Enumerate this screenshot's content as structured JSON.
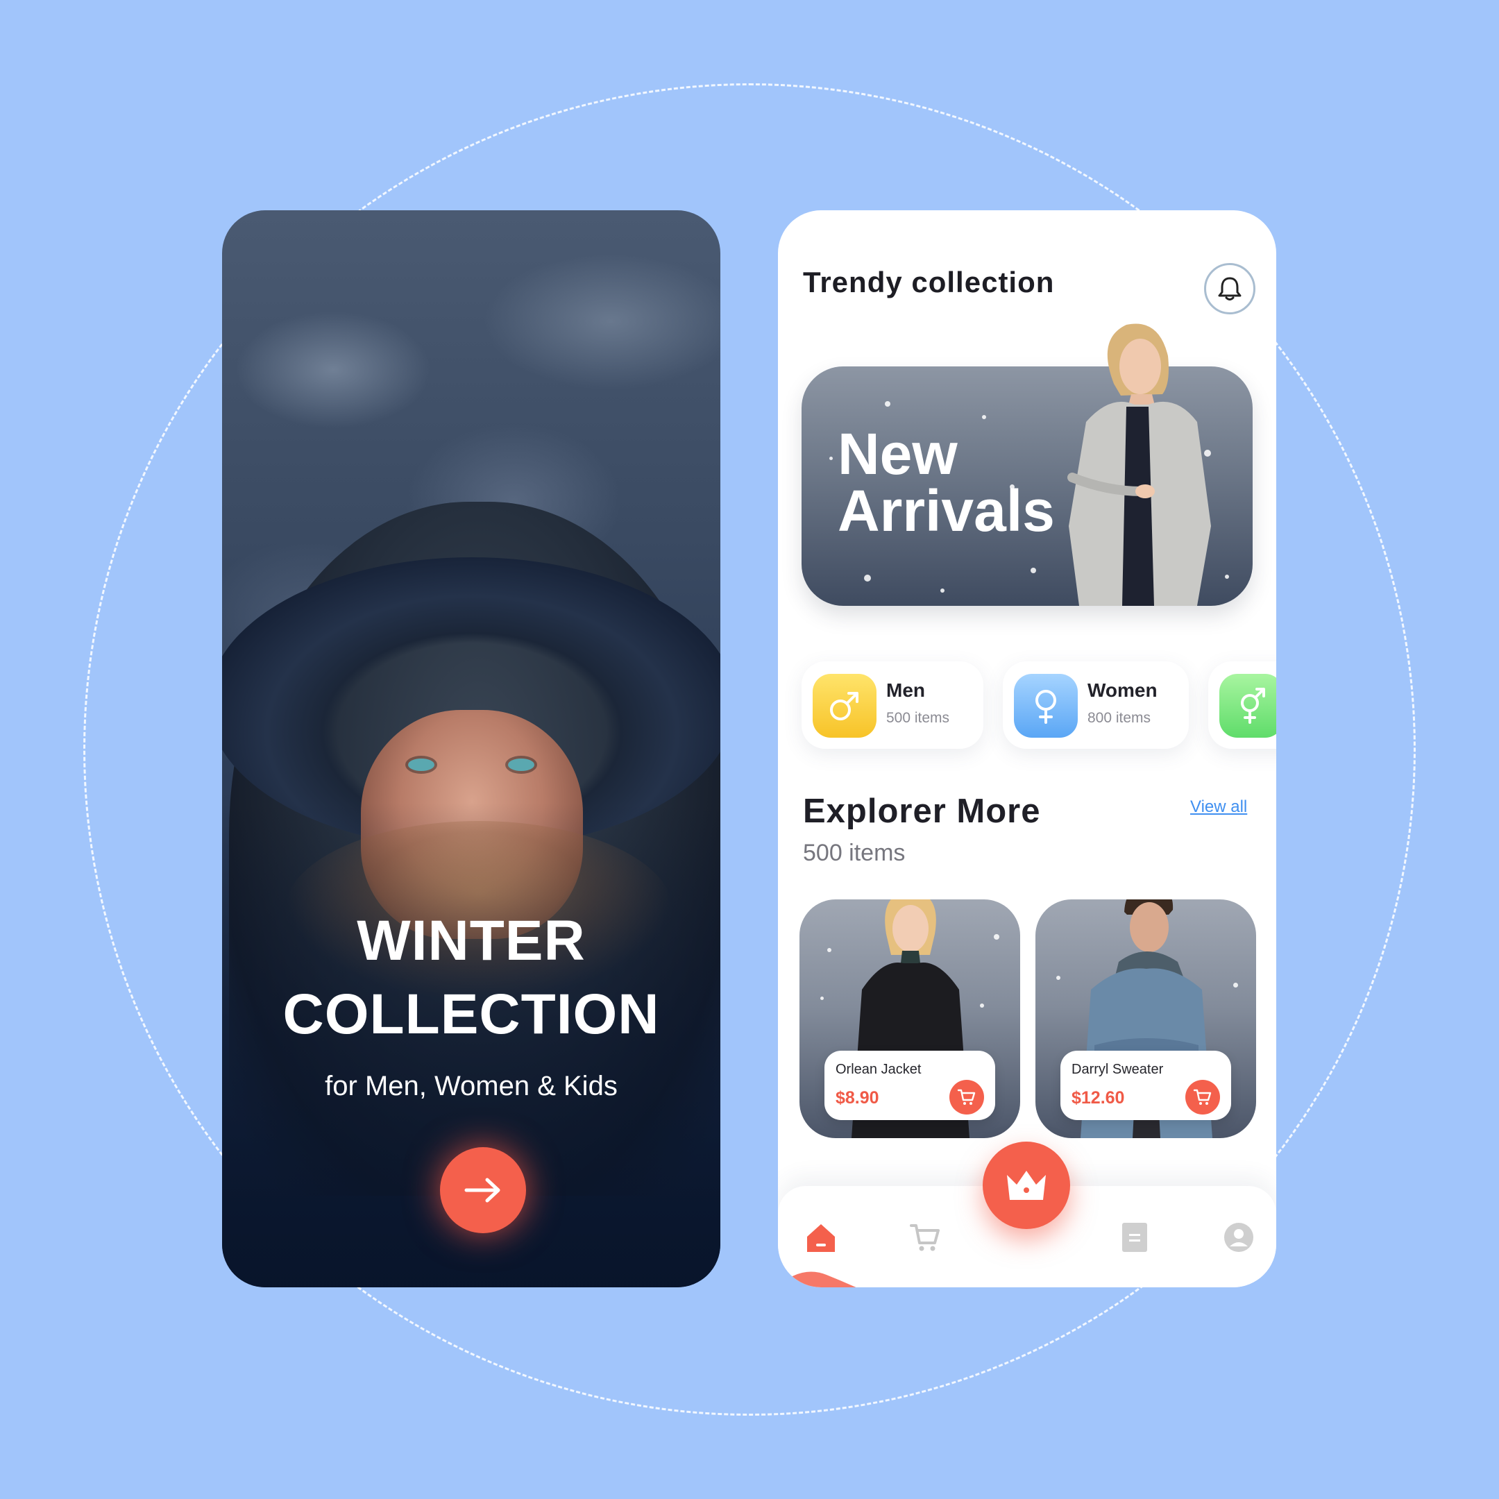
{
  "intro": {
    "title_line1": "WINTER",
    "title_line2": "COLLECTION",
    "subtitle": "for Men, Women & Kids",
    "next_icon": "arrow-right-icon"
  },
  "home": {
    "header_title": "Trendy collection",
    "notification_icon": "bell-icon",
    "banner": {
      "title_line1": "New",
      "title_line2": "Arrivals"
    },
    "categories": [
      {
        "name": "Men",
        "count": "500 items",
        "icon": "male-symbol-icon",
        "color": "#fbd23e"
      },
      {
        "name": "Women",
        "count": "800 items",
        "icon": "female-symbol-icon",
        "color": "#73b6fa"
      },
      {
        "name": "",
        "count": "",
        "icon": "unisex-symbol-icon",
        "color": "#7eea7e"
      }
    ],
    "explore": {
      "title": "Explorer More",
      "count": "500 items",
      "view_all": "View all"
    },
    "products": [
      {
        "name": "Orlean Jacket",
        "price": "$8.90"
      },
      {
        "name": "Darryl Sweater",
        "price": "$12.60"
      }
    ],
    "nav": {
      "items": [
        "home-icon",
        "cart-icon",
        "crown-icon",
        "document-icon",
        "profile-icon"
      ],
      "active": "home-icon"
    }
  },
  "colors": {
    "background": "#a1c5fb",
    "accent": "#f4604c",
    "link": "#3f8ff0"
  }
}
